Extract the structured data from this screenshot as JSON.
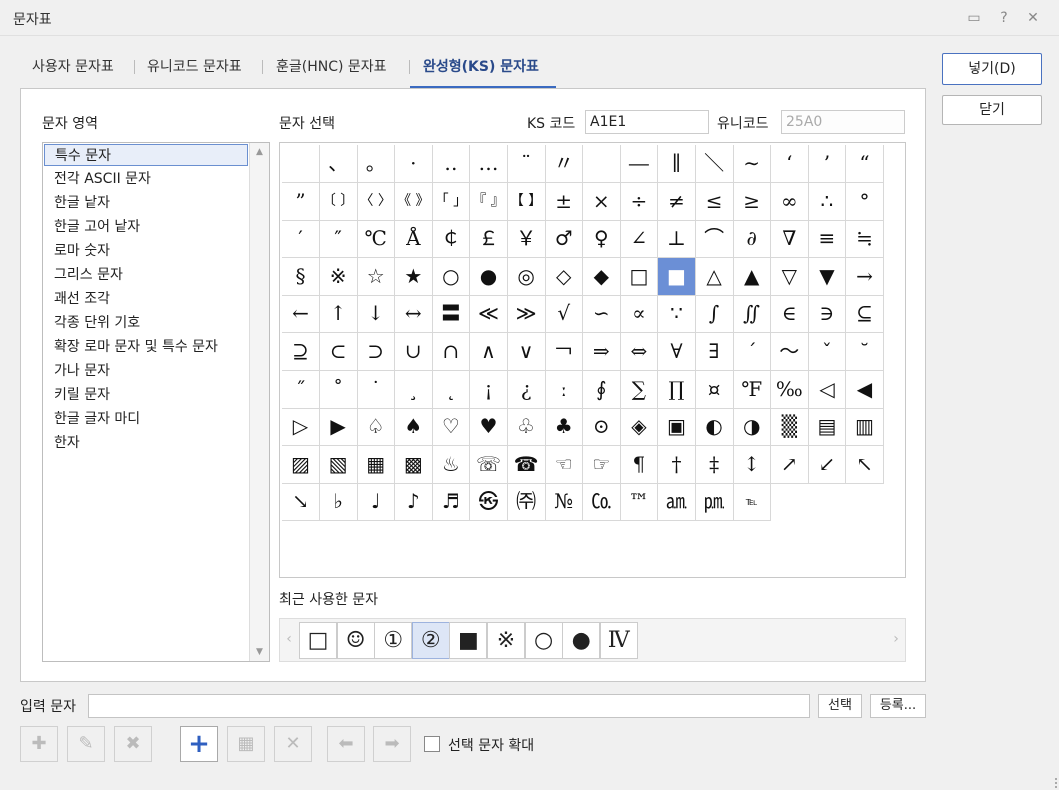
{
  "window": {
    "title": "문자표"
  },
  "tabs": [
    {
      "label": "사용자 문자표"
    },
    {
      "label": "유니코드 문자표"
    },
    {
      "label": "훈글(HNC) 문자표"
    },
    {
      "label": "완성형(KS) 문자표"
    }
  ],
  "active_tab": "완성형(KS) 문자표",
  "buttons": {
    "insert": "넣기(D)",
    "close": "닫기",
    "select": "선택",
    "register": "등록..."
  },
  "area": {
    "label": "문자 영역",
    "items": [
      "특수 문자",
      "전각 ASCII 문자",
      "한글 낱자",
      "한글 고어 낱자",
      "로마 숫자",
      "그리스 문자",
      "괘선 조각",
      "각종 단위 기호",
      "확장 로마 문자 및 특수 문자",
      "가나 문자",
      "키릴 문자",
      "한글 글자 마디",
      "한자"
    ],
    "selected": "특수 문자"
  },
  "select": {
    "label": "문자 선택",
    "ks_label": "KS 코드",
    "ks_value": "A1E1",
    "uni_label": "유니코드",
    "uni_value": "25A0"
  },
  "grid_chars": [
    " ",
    "、",
    "。",
    "·",
    "‥",
    "…",
    "¨",
    "〃",
    "­",
    "―",
    "∥",
    "＼",
    "∼",
    "‘",
    "’",
    "“",
    "”",
    "〔 〕",
    "〈 〉",
    "《 》",
    "「 」",
    "『 』",
    "【 】",
    "±",
    "×",
    "÷",
    "≠",
    "≤",
    "≥",
    "∞",
    "∴",
    "°",
    "′",
    "″",
    "℃",
    "Å",
    "￠",
    "￡",
    "￥",
    "♂",
    "♀",
    "∠",
    "⊥",
    "⌒",
    "∂",
    "∇",
    "≡",
    "≒",
    "§",
    "※",
    "☆",
    "★",
    "○",
    "●",
    "◎",
    "◇",
    "◆",
    "□",
    "■",
    "△",
    "▲",
    "▽",
    "▼",
    "→",
    "←",
    "↑",
    "↓",
    "↔",
    "〓",
    "≪",
    "≫",
    "√",
    "∽",
    "∝",
    "∵",
    "∫",
    "∬",
    "∈",
    "∋",
    "⊆",
    "⊇",
    "⊂",
    "⊃",
    "∪",
    "∩",
    "∧",
    "∨",
    "￢",
    "⇒",
    "⇔",
    "∀",
    "∃",
    "´",
    "～",
    "ˇ",
    "˘",
    "˝",
    "˚",
    "˙",
    "¸",
    "˛",
    "¡",
    "¿",
    "ː",
    "∮",
    "∑",
    "∏",
    "¤",
    "℉",
    "‰",
    "◁",
    "◀",
    "▷",
    "▶",
    "♤",
    "♠",
    "♡",
    "♥",
    "♧",
    "♣",
    "⊙",
    "◈",
    "▣",
    "◐",
    "◑",
    "▒",
    "▤",
    "▥",
    "▨",
    "▧",
    "▦",
    "▩",
    "♨",
    "☏",
    "☎",
    "☜",
    "☞",
    "¶",
    "†",
    "‡",
    "↕",
    "↗",
    "↙",
    "↖",
    "↘",
    "♭",
    "♩",
    "♪",
    "♬",
    "㉿",
    "㈜",
    "№",
    "㏇",
    "™",
    "㏂",
    "㏘",
    "℡"
  ],
  "selected_char": "■",
  "recent": {
    "label": "최근 사용한 문자",
    "chars": [
      "□",
      "☺",
      "①",
      "②",
      "■",
      "※",
      "○",
      "●",
      "Ⅳ"
    ],
    "selected": "②"
  },
  "input": {
    "label": "입력 문자",
    "value": ""
  },
  "option": {
    "label": "선택 문자 확대",
    "checked": false
  },
  "toolbar_icons": [
    "add-char-icon",
    "edit-char-icon",
    "delete-char-icon",
    "add-icon",
    "add-row-icon",
    "delete-icon",
    "move-left-icon",
    "move-right-icon"
  ]
}
